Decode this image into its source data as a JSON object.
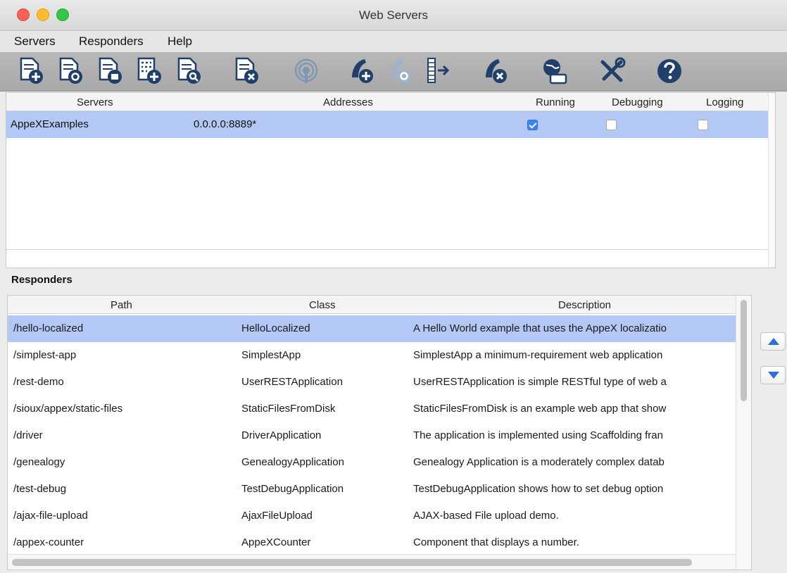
{
  "window": {
    "title": "Web Servers"
  },
  "menu": {
    "items": [
      "Servers",
      "Responders",
      "Help"
    ]
  },
  "toolbar": {
    "icons": [
      "add-server-icon",
      "start-server-icon",
      "save-server-icon",
      "add-binary-icon",
      "inspect-server-icon",
      "delete-server-icon",
      "broadcast-icon",
      "add-responder-icon",
      "responder-settings-icon",
      "compress-icon",
      "remove-responder-icon",
      "network-icon",
      "tools-icon",
      "help-icon"
    ]
  },
  "colors": {
    "selection": "#b3c8f4",
    "toolbar_icon": "#20406b",
    "accent": "#3a82f7"
  },
  "servers": {
    "headers": [
      "Servers",
      "Addresses",
      "Running",
      "Debugging",
      "Logging"
    ],
    "rows": [
      {
        "name": "AppeXExamples",
        "address": "0.0.0.0:8889*",
        "running": true,
        "debugging": false,
        "logging": false
      }
    ]
  },
  "responders": {
    "label": "Responders",
    "headers": [
      "Path",
      "Class",
      "Description"
    ],
    "rows": [
      {
        "path": "/hello-localized",
        "class": "HelloLocalized",
        "description": "A Hello World example that uses the AppeX localizatio"
      },
      {
        "path": "/simplest-app",
        "class": "SimplestApp",
        "description": "SimplestApp a minimum-requirement web application"
      },
      {
        "path": "/rest-demo",
        "class": "UserRESTApplication",
        "description": "UserRESTApplication is simple RESTful type of web a"
      },
      {
        "path": "/sioux/appex/static-files",
        "class": "StaticFilesFromDisk",
        "description": "StaticFilesFromDisk is an example web app that show"
      },
      {
        "path": "/driver",
        "class": "DriverApplication",
        "description": "The application is implemented using Scaffolding fran"
      },
      {
        "path": "/genealogy",
        "class": "GenealogyApplication",
        "description": "Genealogy Application is a moderately complex datab"
      },
      {
        "path": "/test-debug",
        "class": "TestDebugApplication",
        "description": "TestDebugApplication shows how to set debug option"
      },
      {
        "path": "/ajax-file-upload",
        "class": "AjaxFileUpload",
        "description": "AJAX-based File upload demo."
      },
      {
        "path": "/appex-counter",
        "class": "AppeXCounter",
        "description": "Component that displays a number."
      }
    ],
    "move_up_icon": "arrow-up-icon",
    "move_down_icon": "arrow-down-icon"
  }
}
